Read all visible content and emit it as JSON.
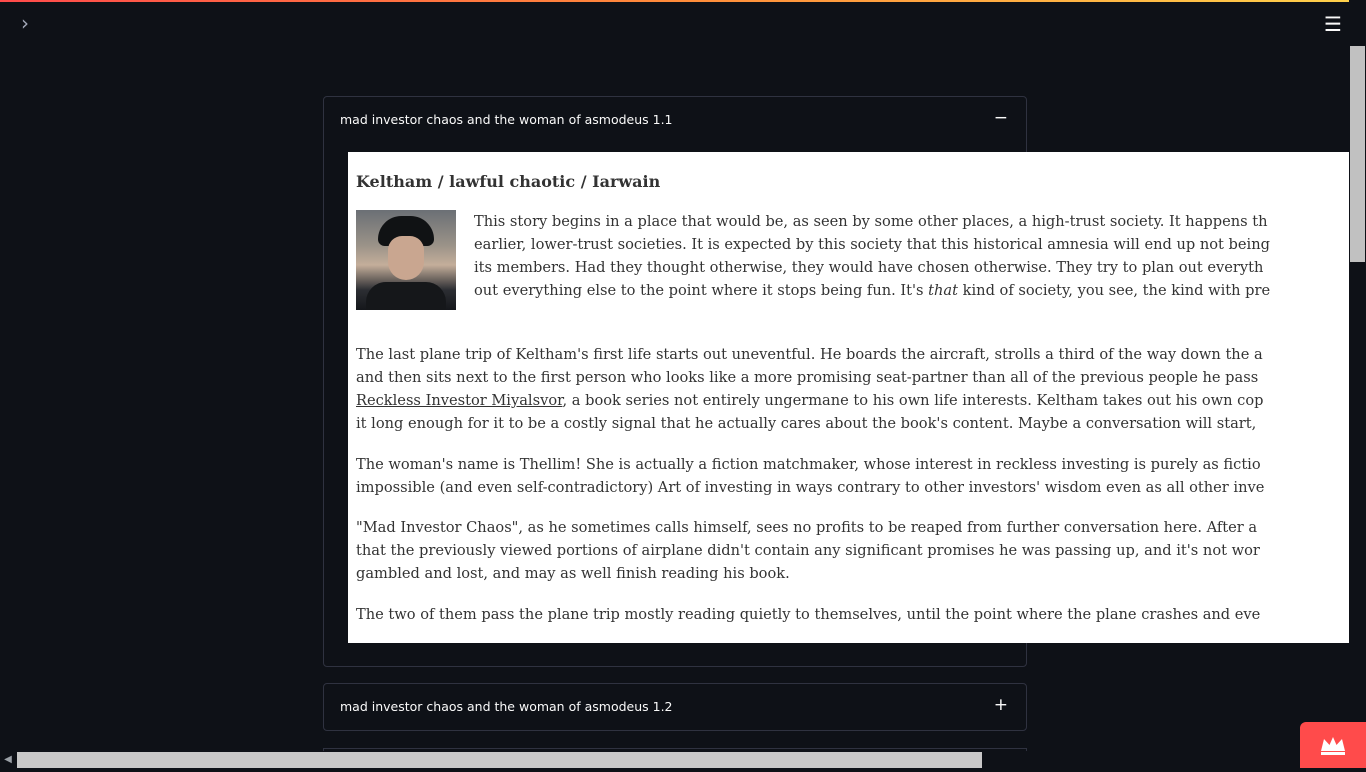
{
  "icons": {
    "sidebar_toggle": "chevron-right-icon",
    "main_menu": "hamburger-menu-icon",
    "badge": "crown-icon"
  },
  "colors": {
    "background": "#0e1117",
    "accent": "#ff4b4b",
    "post_background": "#ffffff"
  },
  "expanders": [
    {
      "label": "mad investor chaos and the woman of asmodeus 1.1",
      "toggle": "−"
    },
    {
      "label": "mad investor chaos and the woman of asmodeus 1.2",
      "toggle": "+"
    }
  ],
  "post": {
    "title": "Keltham / lawful chaotic / Iarwain",
    "intro": [
      "This story begins in a place that would be, as seen by some other places, a high-trust society.  It happens th",
      "earlier, lower-trust societies.  It is expected by this society that this historical amnesia will end up not being",
      "its members.  Had they thought otherwise, they would have chosen otherwise.  They try to plan out everyth"
    ],
    "intro_last": {
      "before": "out everything else to the point where it stops being fun.  It's ",
      "emph": "that",
      "after": " kind of society, you see, the kind with pre"
    },
    "para1": {
      "line1": "The last plane trip of Keltham's first life starts out uneventful.  He boards the aircraft, strolls a third of the way down the a",
      "line2": "and then sits next to the first person who looks like a more promising seat-partner than all of the previous people he pass",
      "line3_link": "Reckless Investor Miyalsvor",
      "line3_rest": ", a book series not entirely ungermane to his own life interests.  Keltham takes out his own cop",
      "line4": "it long enough for it to be a costly signal that he actually cares about the book's content.  Maybe a conversation will start,"
    },
    "para2": [
      "The woman's name is Thellim!  She is actually a fiction matchmaker, whose interest in reckless investing is purely as fictio",
      "impossible (and even self-contradictory) Art of investing in ways contrary to other investors' wisdom even as all other inve"
    ],
    "para3": [
      "\"Mad Investor Chaos\", as he sometimes calls himself, sees no profits to be reaped from further conversation here.  After a",
      "that the previously viewed portions of airplane didn't contain any significant promises he was passing up, and it's not wor",
      "gambled and lost, and may as well finish reading his book."
    ],
    "para4": "The two of them pass the plane trip mostly reading quietly to themselves, until the point where the plane crashes and eve"
  }
}
